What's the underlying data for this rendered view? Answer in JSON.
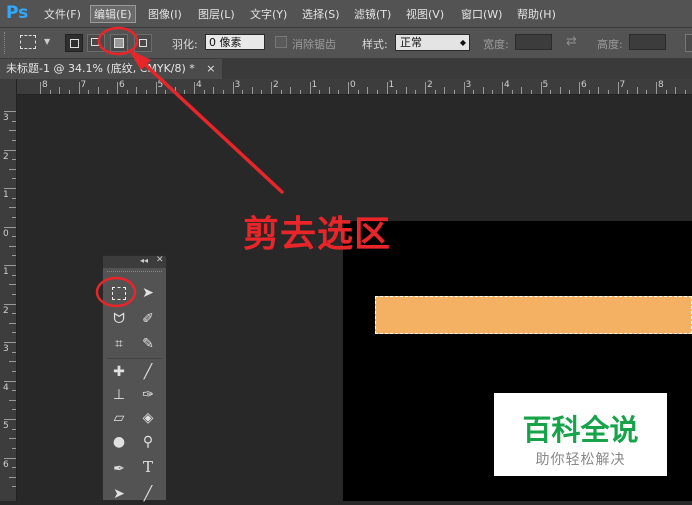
{
  "app": {
    "logo": "Ps"
  },
  "menu": [
    "文件(F)",
    "编辑(E)",
    "图像(I)",
    "图层(L)",
    "文字(Y)",
    "选择(S)",
    "滤镜(T)",
    "视图(V)",
    "窗口(W)",
    "帮助(H)"
  ],
  "options": {
    "feather_label": "羽化:",
    "feather_value": "0 像素",
    "antialias_label": "消除锯齿",
    "style_label": "样式:",
    "style_value": "正常",
    "width_label": "宽度:",
    "height_label": "高度:"
  },
  "document": {
    "tab_title": "未标题-1 @ 34.1% (底纹, CMYK/8) *",
    "tab_close": "×"
  },
  "ruler_h": [
    "8",
    "7",
    "6",
    "5",
    "4",
    "3",
    "2",
    "1",
    "0",
    "1",
    "2",
    "3",
    "4",
    "5",
    "6",
    "7",
    "8"
  ],
  "ruler_v": [
    "3",
    "2",
    "1",
    "0",
    "1",
    "2",
    "3",
    "4",
    "5",
    "6"
  ],
  "tools": {
    "panel_collapse": "◂◂",
    "panel_close": "✕",
    "type_tool": "T"
  },
  "annotation": {
    "caption": "剪去选区"
  },
  "watermark": {
    "main": "百科全说",
    "sub": "助你轻松解决"
  },
  "colors": {
    "selection_fill": "#f4b164",
    "annotation_red": "#e8262a",
    "watermark_green": "#16a34a"
  }
}
